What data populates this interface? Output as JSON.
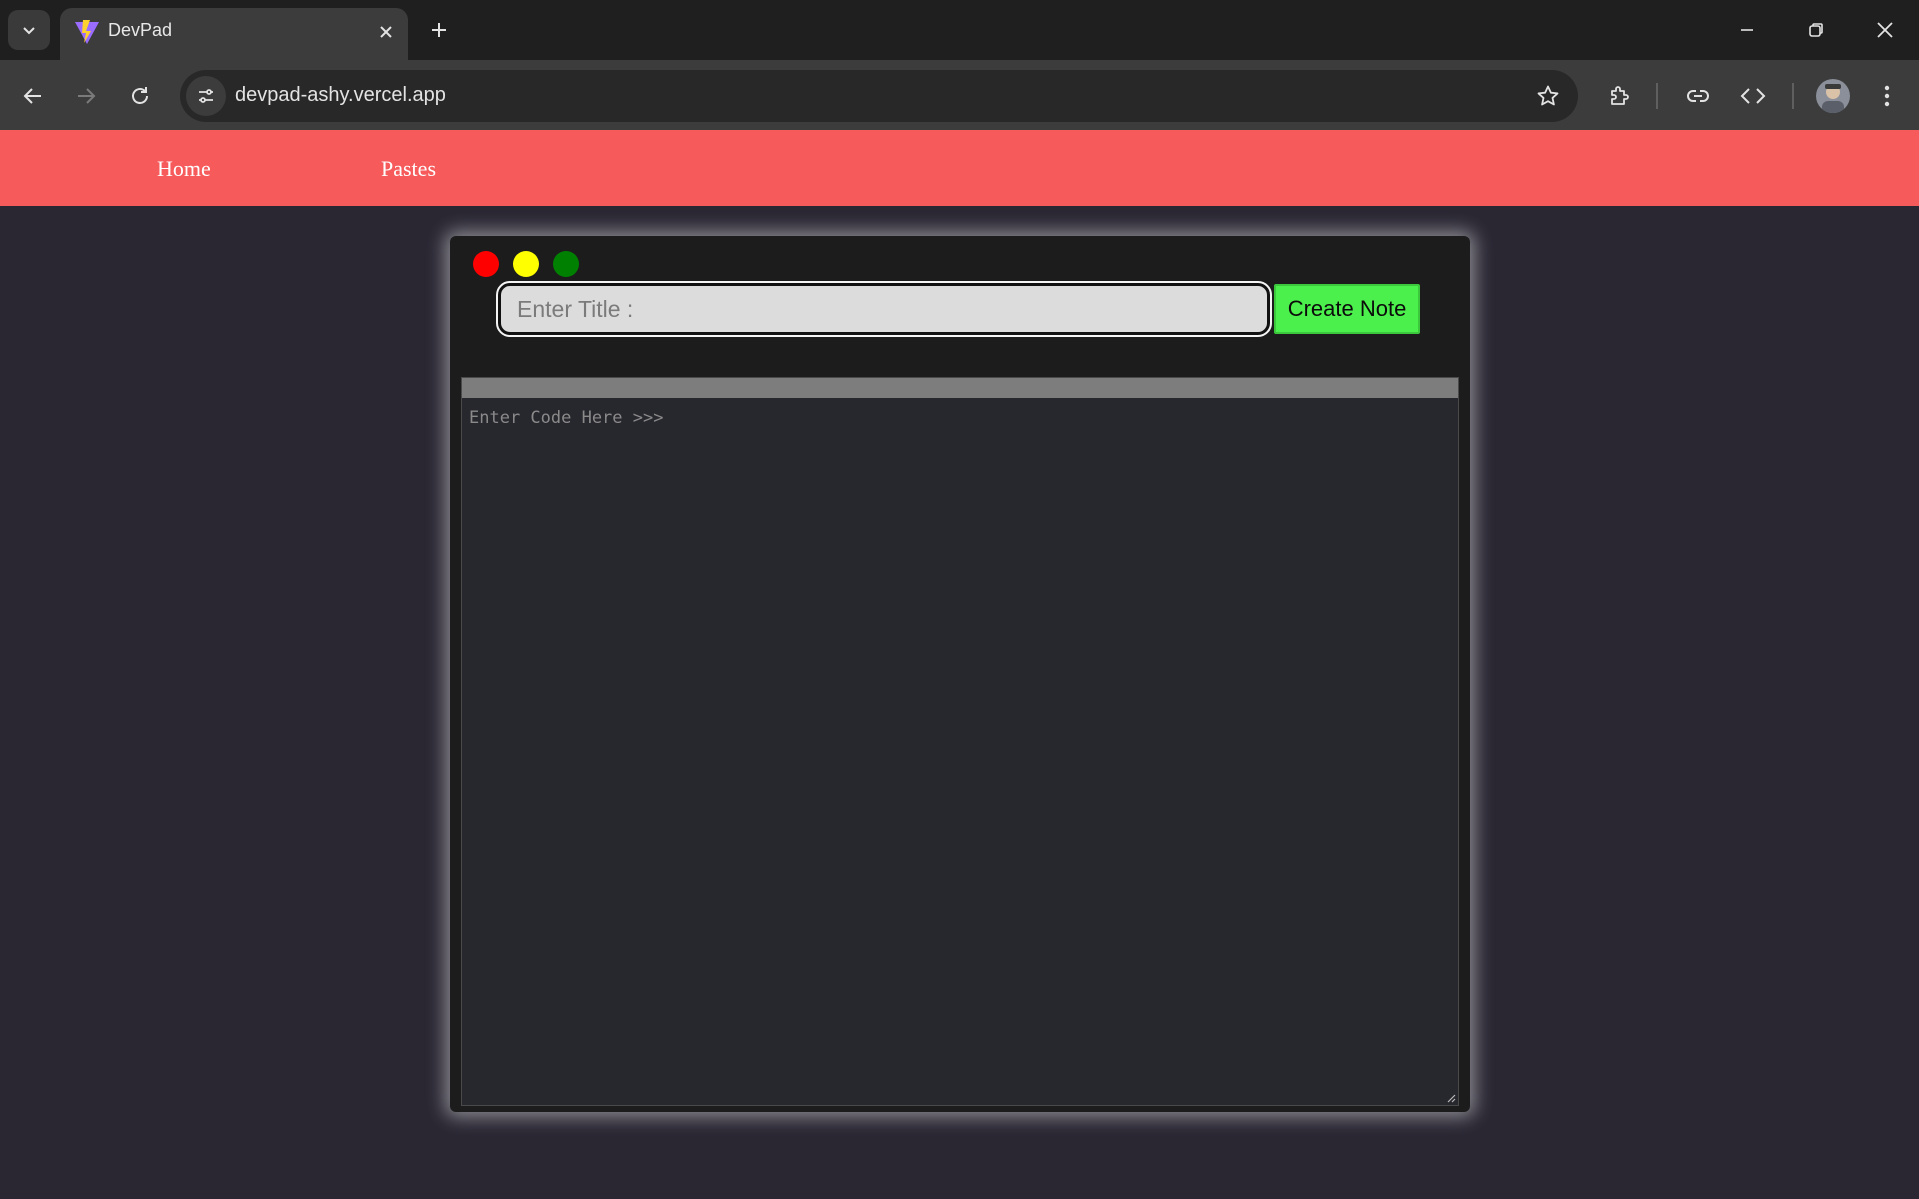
{
  "browser": {
    "tab": {
      "title": "DevPad",
      "favicon": "vite-icon"
    },
    "url": "devpad-ashy.vercel.app",
    "icons": {
      "tab_search": "chevron-down-icon",
      "new_tab": "plus-icon",
      "back": "arrow-left-icon",
      "forward": "arrow-right-icon",
      "reload": "reload-icon",
      "site_info": "tune-icon",
      "bookmark": "star-icon",
      "extensions": "puzzle-icon",
      "link": "link-icon",
      "devtools": "code-icon",
      "menu": "kebab-icon"
    }
  },
  "navbar": {
    "color": "#f65a5b",
    "links": [
      {
        "label": "Home"
      },
      {
        "label": "Pastes"
      }
    ]
  },
  "editor_window": {
    "traffic_lights": [
      "#ff0000",
      "#ffff00",
      "#008000"
    ],
    "title_placeholder": "Enter Title :",
    "title_value": "",
    "create_button": "Create Note",
    "create_button_color": "#4cf04c",
    "code_placeholder": "Enter Code Here >>>",
    "code_value": ""
  }
}
